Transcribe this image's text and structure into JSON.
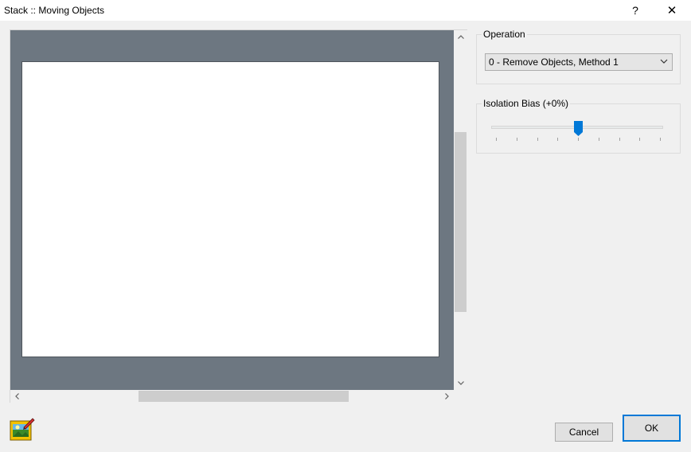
{
  "window": {
    "title": "Stack :: Moving Objects",
    "help": "?",
    "close": "✕"
  },
  "operation": {
    "label": "Operation",
    "selected": "0 - Remove Objects, Method 1"
  },
  "isolation": {
    "label": "Isolation Bias (+0%)",
    "slider_value": 0.5,
    "tick_count": 9
  },
  "scroll": {
    "up": "˄",
    "down": "˅",
    "left": "<",
    "right": ">"
  },
  "buttons": {
    "cancel": "Cancel",
    "ok": "OK"
  },
  "colors": {
    "accent": "#0078d7",
    "preview_bg": "#6d7781"
  }
}
